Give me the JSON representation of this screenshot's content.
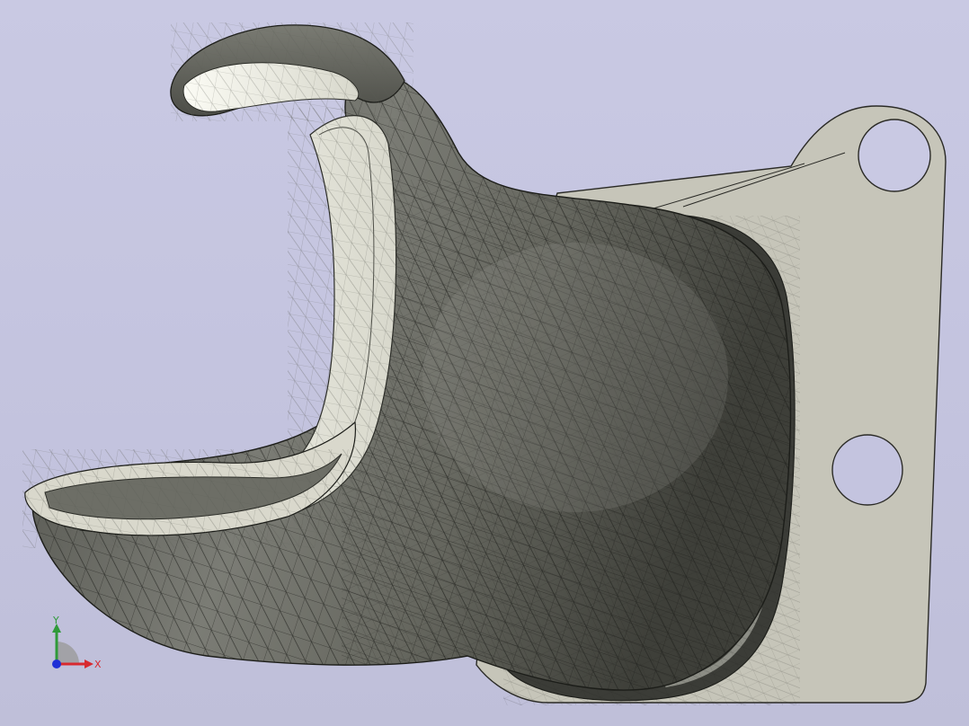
{
  "viewport": {
    "background_top": "#c9c9e3",
    "background_bottom": "#bfbfd9",
    "mesh_color": "#2b2d28",
    "bracket_color": "#c5c4b8"
  },
  "triad": {
    "x_label": "X",
    "y_label": "Y",
    "x_color": "#d8292f",
    "y_color": "#2f9a3a",
    "z_color": "#1f2fd6"
  }
}
